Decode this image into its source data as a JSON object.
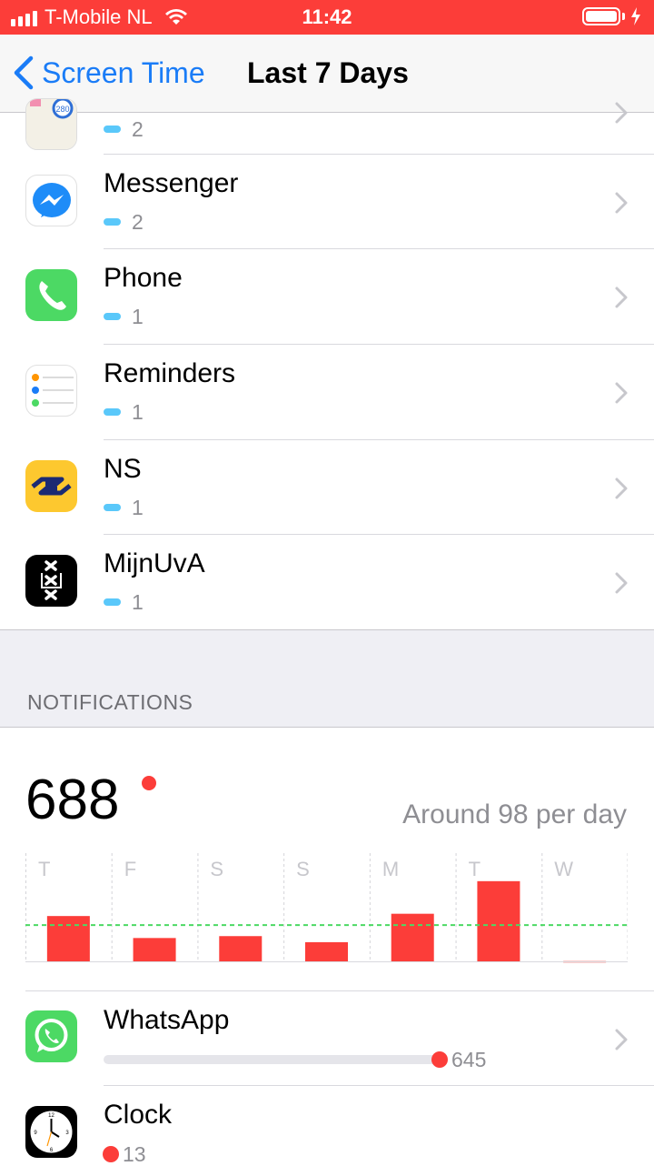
{
  "status_bar": {
    "carrier": "T-Mobile NL",
    "time": "11:42"
  },
  "nav": {
    "back_label": "Screen Time",
    "title": "Last 7 Days"
  },
  "app_list": [
    {
      "name": "",
      "count": "2",
      "icon": "maps-icon"
    },
    {
      "name": "Messenger",
      "count": "2",
      "icon": "messenger-icon"
    },
    {
      "name": "Phone",
      "count": "1",
      "icon": "phone-icon"
    },
    {
      "name": "Reminders",
      "count": "1",
      "icon": "reminders-icon"
    },
    {
      "name": "NS",
      "count": "1",
      "icon": "ns-icon"
    },
    {
      "name": "MijnUvA",
      "count": "1",
      "icon": "mijnuva-icon"
    }
  ],
  "notifications": {
    "section_header": "NOTIFICATIONS",
    "total": "688",
    "average": "Around 98 per day",
    "apps": [
      {
        "name": "WhatsApp",
        "count": "645",
        "icon": "whatsapp-icon",
        "fraction": 1.0
      },
      {
        "name": "Clock",
        "count": "13",
        "icon": "clock-icon",
        "fraction": 0.02
      }
    ]
  },
  "colors": {
    "status_red": "#fc3d39",
    "link_blue": "#1a7cf7",
    "pickup_blue": "#5ac8fa",
    "average_green": "#4cd964"
  },
  "chart_data": {
    "type": "bar",
    "categories": [
      "T",
      "F",
      "S",
      "S",
      "M",
      "T",
      "W"
    ],
    "values": [
      122,
      64,
      69,
      53,
      128,
      214,
      3
    ],
    "average": 98,
    "ylim": [
      0,
      240
    ],
    "grid": true
  }
}
